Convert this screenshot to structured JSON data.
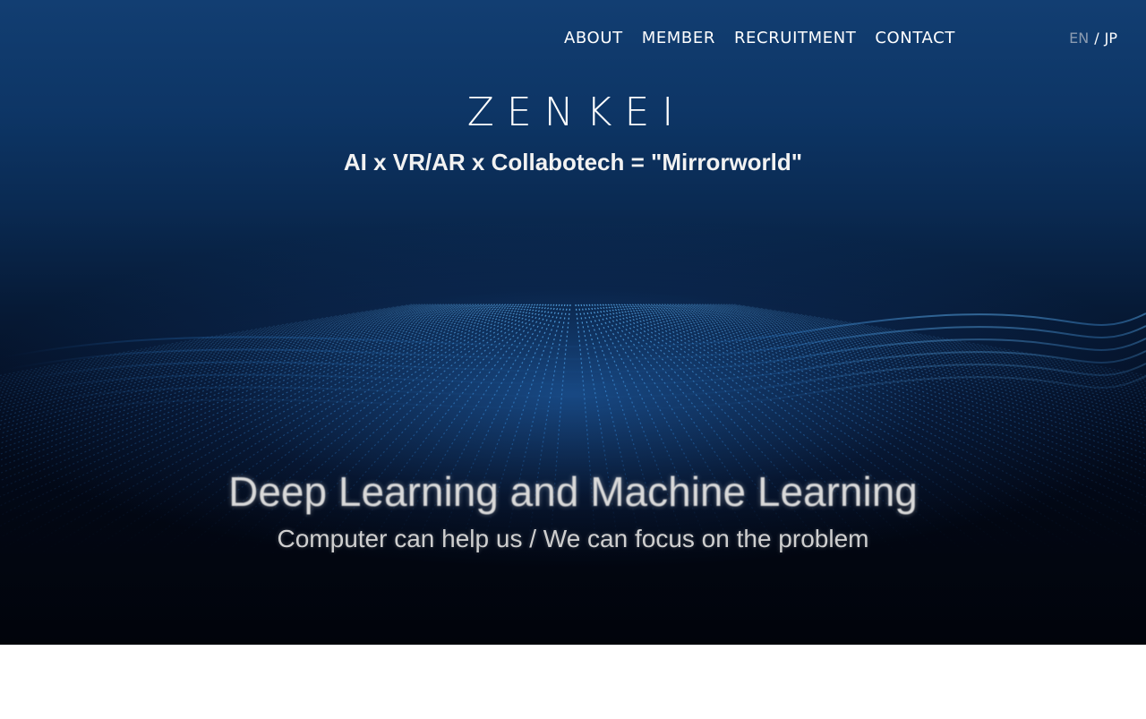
{
  "nav": {
    "items": [
      {
        "label": "ABOUT"
      },
      {
        "label": "MEMBER"
      },
      {
        "label": "RECRUITMENT"
      },
      {
        "label": "CONTACT"
      }
    ]
  },
  "language": {
    "active": "EN",
    "separator": "/",
    "other": "JP"
  },
  "hero": {
    "logo_text": "ZENKEI",
    "tagline": "AI x VR/AR x Collabotech = \"Mirrorworld\"",
    "video_caption_title": "Deep Learning and Machine Learning",
    "video_caption_subtitle": "Computer can help us / We can focus on the problem"
  },
  "colors": {
    "hero_top": "#123e72",
    "hero_bottom": "#01040b",
    "wave_accent": "#3a9be8",
    "lang_active": "#8a9bb1"
  }
}
